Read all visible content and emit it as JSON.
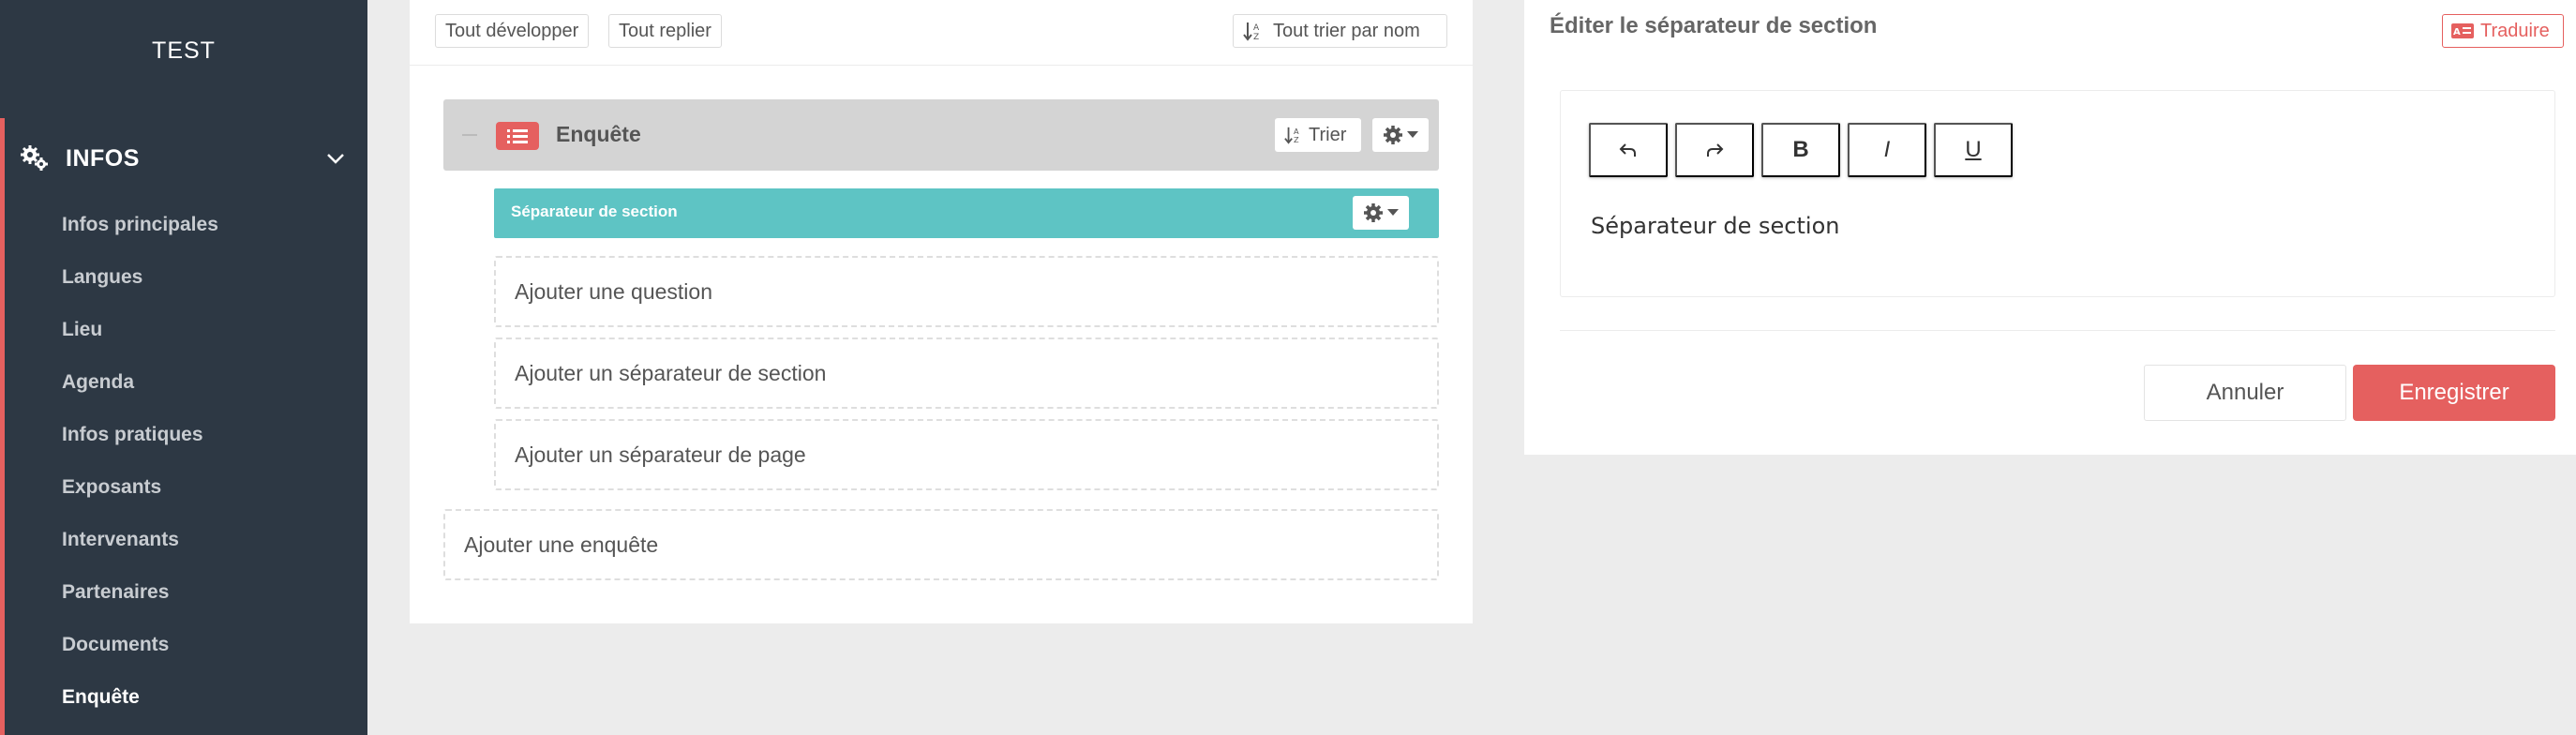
{
  "sidebar": {
    "brand": "TEST",
    "section_title": "INFOS",
    "items": [
      {
        "label": "Infos principales"
      },
      {
        "label": "Langues"
      },
      {
        "label": "Lieu"
      },
      {
        "label": "Agenda"
      },
      {
        "label": "Infos pratiques"
      },
      {
        "label": "Exposants"
      },
      {
        "label": "Intervenants"
      },
      {
        "label": "Partenaires"
      },
      {
        "label": "Documents"
      },
      {
        "label": "Enquête"
      }
    ],
    "active_item": "Enquête"
  },
  "toolbar": {
    "expand_all": "Tout développer",
    "collapse_all": "Tout replier",
    "sort_all": "Tout trier par nom"
  },
  "survey": {
    "title": "Enquête",
    "sort_label": "Trier",
    "section_separator_label": "Séparateur de section",
    "add_question": "Ajouter une question",
    "add_section_separator": "Ajouter un séparateur de section",
    "add_page_separator": "Ajouter un séparateur de page",
    "add_survey": "Ajouter une enquête"
  },
  "editor_panel": {
    "heading": "Éditer le séparateur de section",
    "translate_label": "Traduire",
    "content": "Séparateur de section",
    "toolbar_buttons": [
      "undo",
      "redo",
      "B",
      "I",
      "U"
    ],
    "cancel_label": "Annuler",
    "save_label": "Enregistrer"
  },
  "colors": {
    "sidebar_bg": "#2d3844",
    "accent": "#e5605f",
    "separator_teal": "#5ec4c4",
    "survey_header_bg": "#d4d4d4"
  },
  "icons": [
    "gears-icon",
    "chevron-down-icon",
    "sort-icon",
    "list-icon",
    "gear-icon",
    "caret-down-icon",
    "translate-icon",
    "undo-icon",
    "redo-icon",
    "bold-icon",
    "italic-icon",
    "underline-icon"
  ]
}
